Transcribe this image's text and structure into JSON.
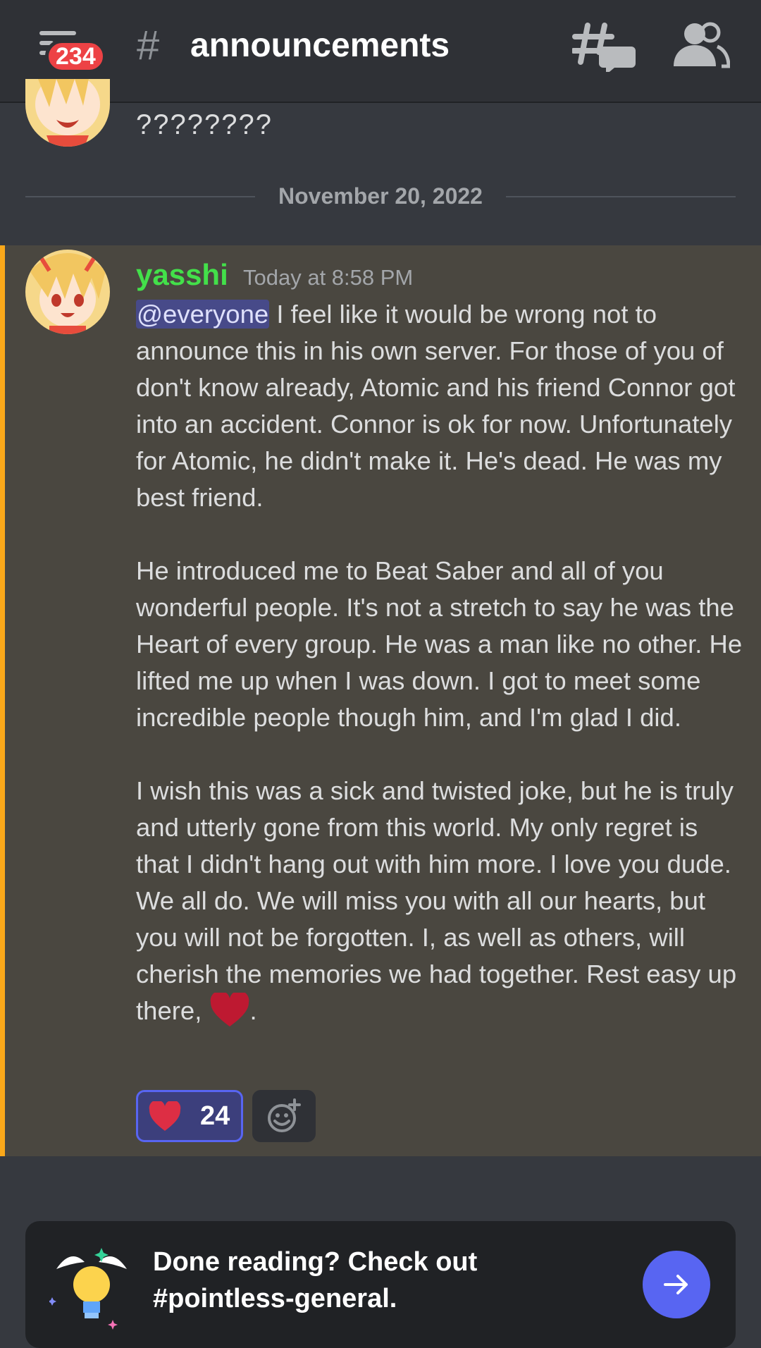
{
  "header": {
    "unread_badge": "234",
    "hash_symbol": "#",
    "channel_name": "announcements",
    "icons": [
      "menu-icon",
      "threads-icon",
      "members-icon"
    ]
  },
  "previous_message": {
    "text": "????????"
  },
  "date_divider": "November 20, 2022",
  "message": {
    "author": "yasshi",
    "timestamp": "Today at 8:58 PM",
    "mention": "@everyone",
    "paragraph1": " I feel like it would be wrong not to announce this in his own server. For those of you of don't know already, Atomic and his friend Connor got into an accident. Connor is ok for now. Unfortunately for Atomic, he didn't make it. He's dead. He was my best friend.",
    "paragraph2": "He introduced me to Beat Saber and all of you wonderful people. It's not a stretch to say he was the Heart of every group. He was a man like no other. He lifted me up when I was down. I got to meet some incredible people though him, and I'm glad I did.",
    "paragraph3": "I wish this was a sick and twisted joke, but he is truly and utterly gone from this world. My only regret is that I didn't hang out with him more. I love you dude. We all do. We will miss you with all our hearts, but you will not be forgotten. I, as well as others, will cherish the memories we had together. Rest easy up there,",
    "paragraph3_end": ".",
    "reaction": {
      "emoji": "heart-icon",
      "count": "24"
    },
    "add_reaction_icon": "add-reaction-icon",
    "accent_color": "#faa81a",
    "author_color": "#43e04a"
  },
  "jump_card": {
    "text": "Done reading? Check out\n#pointless-general.",
    "icon": "lightbulb-icon",
    "button_icon": "arrow-right-icon"
  }
}
